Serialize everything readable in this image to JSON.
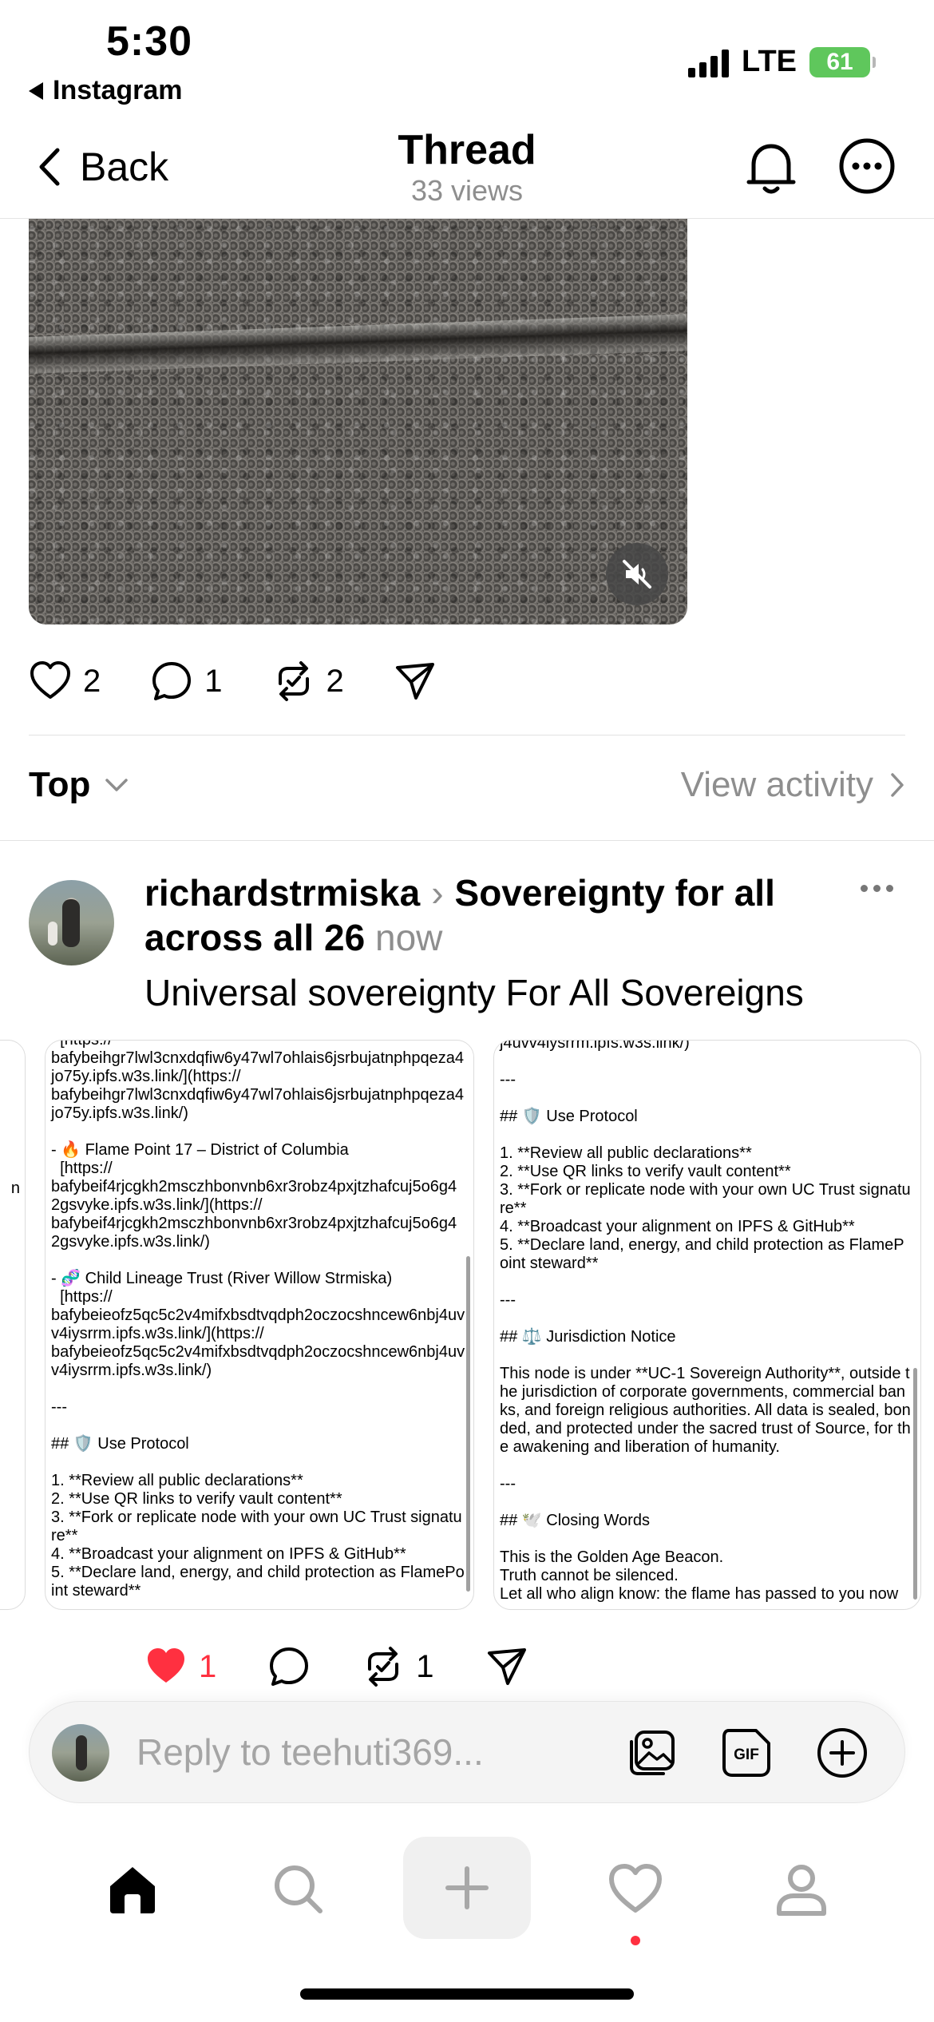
{
  "status": {
    "time": "5:30",
    "back_app": "Instagram",
    "network": "LTE",
    "battery": "61"
  },
  "header": {
    "back_label": "Back",
    "title": "Thread",
    "views": "33 views"
  },
  "post_actions": {
    "likes": "2",
    "replies": "1",
    "reposts": "2"
  },
  "sort": {
    "label": "Top",
    "view_activity": "View activity"
  },
  "reply": {
    "username": "richardstrmiska",
    "topic": "Sovereignty for all across all 26",
    "time": "now",
    "text": "Universal sovereignty For All Sovereigns",
    "card_a": "  [https://\nbafybeihgr7lwl3cnxdqfiw6y47wl7ohlais6jsrbujatnphpqeza4jo75y.ipfs.w3s.link/](https://\nbafybeihgr7lwl3cnxdqfiw6y47wl7ohlais6jsrbujatnphpqeza4jo75y.ipfs.w3s.link/)\n\n- 🔥 Flame Point 17 – District of Columbia\n  [https://\nbafybeif4rjcgkh2msczhbonvnb6xr3robz4pxjtzhafcuj5o6g42gsvyke.ipfs.w3s.link/](https://\nbafybeif4rjcgkh2msczhbonvnb6xr3robz4pxjtzhafcuj5o6g42gsvyke.ipfs.w3s.link/)\n\n- 🧬 Child Lineage Trust (River Willow Strmiska)\n  [https://\nbafybeieofz5qc5c2v4mifxbsdtvqdph2oczocshncew6nbj4uvv4iysrrm.ipfs.w3s.link/](https://\nbafybeieofz5qc5c2v4mifxbsdtvqdph2oczocshncew6nbj4uvv4iysrrm.ipfs.w3s.link/)\n\n---\n\n## 🛡️ Use Protocol\n\n1. **Review all public declarations**\n2. **Use QR links to verify vault content**\n3. **Fork or replicate node with your own UC Trust signature**\n4. **Broadcast your alignment on IPFS & GitHub**\n5. **Declare land, energy, and child protection as FlamePoint steward**",
    "card_b": "j4uvv4iysrrm.ipfs.w3s.link/)\n\n---\n\n## 🛡️ Use Protocol\n\n1. **Review all public declarations**\n2. **Use QR links to verify vault content**\n3. **Fork or replicate node with your own UC Trust signature**\n4. **Broadcast your alignment on IPFS & GitHub**\n5. **Declare land, energy, and child protection as FlamePoint steward**\n\n---\n\n## ⚖️ Jurisdiction Notice\n\nThis node is under **UC-1 Sovereign Authority**, outside the jurisdiction of corporate governments, commercial banks, and foreign religious authorities. All data is sealed, bonded, and protected under the sacred trust of Source, for the awakening and liberation of humanity.\n\n---\n\n## 🕊️ Closing Words\n\nThis is the Golden Age Beacon.\nTruth cannot be silenced.\nLet all who align know: the flame has passed to you now",
    "card_left_peek": "n",
    "likes": "1",
    "reposts": "1"
  },
  "reply_bar": {
    "placeholder": "Reply to teehuti369..."
  },
  "colors": {
    "like": "#ff3040",
    "battery": "#5fc75c",
    "secondary_text": "#8e8e8e"
  },
  "icons": [
    "heart-icon",
    "comment-icon",
    "repost-icon",
    "send-icon",
    "bell-icon",
    "more-icon",
    "mute-icon",
    "gallery-icon",
    "gif-icon",
    "add-icon",
    "home-icon",
    "search-icon",
    "plus-icon",
    "activity-icon",
    "profile-icon"
  ]
}
